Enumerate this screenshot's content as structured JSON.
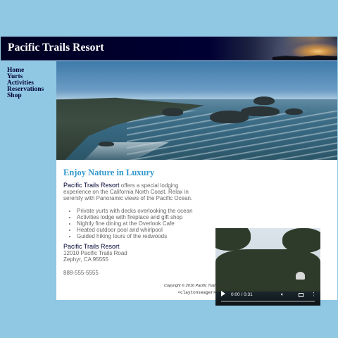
{
  "header": {
    "title": "Pacific Trails Resort"
  },
  "nav": {
    "items": [
      "Home",
      "Yurts",
      "Activities",
      "Reservations",
      "Shop"
    ]
  },
  "main": {
    "heading": "Enjoy Nature in Luxury",
    "intro_highlight": "Pacific Trails Resort",
    "intro_text": " offers a special lodging experience on the California North Coast. Relax in serenity with Panoramic views of the Pacific Ocean.",
    "features": [
      "Private yurts with decks overlooking the ocean",
      "Activities lodge with fireplace and gift shop",
      "Nightly fine dining at the Overlook Cafe",
      "Heated outdoor pool and whirlpool",
      "Guided hiking tours of the redwoods"
    ],
    "address": {
      "name": "Pacific Trails Resort",
      "street": "12010 Pacific Trails Road",
      "city": "Zephyr, CA 95555"
    },
    "phone": "888-555-5555"
  },
  "video": {
    "time": "0:00 / 0:31"
  },
  "footer": {
    "copyright": "Copyright © 2016 Pacific Trails Resort",
    "user": "<claytonseager>"
  },
  "colors": {
    "background": "#90c7e3",
    "header": "#000033",
    "heading": "#3399cc",
    "text": "#666666"
  },
  "icons": [
    "play-icon",
    "volume-icon",
    "fullscreen-icon",
    "more-options-icon"
  ]
}
